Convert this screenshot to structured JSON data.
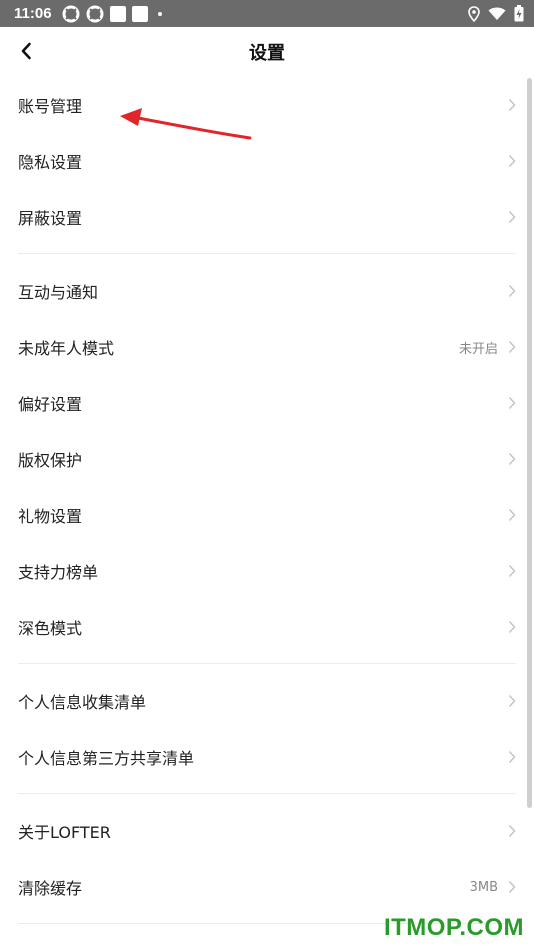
{
  "status_bar": {
    "time": "11:06",
    "icons": [
      "app-notification-icon",
      "app-notification-icon",
      "square-notification-icon",
      "square-notification-icon",
      "dot-icon",
      "location-icon",
      "wifi-icon",
      "battery-icon"
    ]
  },
  "nav": {
    "title": "设置",
    "back_icon": "chevron-left-icon"
  },
  "rows": [
    {
      "label": "账号管理",
      "value": ""
    },
    {
      "label": "隐私设置",
      "value": ""
    },
    {
      "label": "屏蔽设置",
      "value": ""
    },
    {
      "label": "互动与通知",
      "value": ""
    },
    {
      "label": "未成年人模式",
      "value": "未开启"
    },
    {
      "label": "偏好设置",
      "value": ""
    },
    {
      "label": "版权保护",
      "value": ""
    },
    {
      "label": "礼物设置",
      "value": ""
    },
    {
      "label": "支持力榜单",
      "value": ""
    },
    {
      "label": "深色模式",
      "value": ""
    },
    {
      "label": "个人信息收集清单",
      "value": ""
    },
    {
      "label": "个人信息第三方共享清单",
      "value": ""
    },
    {
      "label": "关于LOFTER",
      "value": ""
    },
    {
      "label": "清除缓存",
      "value": "3MB"
    }
  ],
  "colors": {
    "status_bar": "#6b6b6b",
    "arrow": "#e0262b",
    "watermark": "#2a9a2a",
    "chevron": "#c4c4c4"
  },
  "watermark": "ITMOP.COM"
}
